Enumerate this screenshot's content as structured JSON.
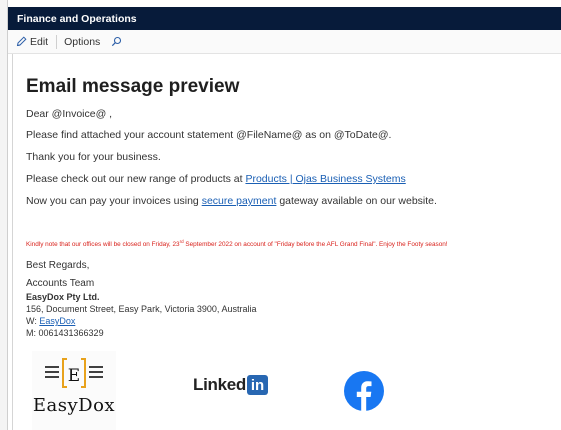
{
  "app": {
    "title": "Finance and Operations"
  },
  "toolbar": {
    "edit_label": "Edit",
    "options_label": "Options"
  },
  "email": {
    "heading": "Email message preview",
    "greeting": "Dear @Invoice@ ,",
    "line1": "Please find attached your account statement @FileName@ as on @ToDate@.",
    "line2": "Thank you for your business.",
    "line3_prefix": "Please check out our new range of products at ",
    "line3_link": "Products | Ojas Business Systems",
    "line4_prefix": "Now you can pay your invoices using ",
    "line4_link": "secure payment",
    "line4_suffix": " gateway available on our website.",
    "notice_prefix": "Kindly note that our offices will be closed on Friday, 23",
    "notice_sup": "rd",
    "notice_suffix": " September 2022 on account of \"Friday before the AFL Grand Final\". Enjoy the Footy season!",
    "colors": {
      "notice": "#d9221c",
      "link": "#1a5fb4",
      "titlebar": "#071b3a"
    }
  },
  "signature": {
    "regards": "Best Regards,",
    "team": "Accounts Team",
    "company": "EasyDox Pty Ltd.",
    "address": "156, Document Street, Easy Park, Victoria 3900, Australia",
    "web_prefix": "W: ",
    "web_link": "EasyDox",
    "mobile": "M: 0061431366329"
  },
  "logos": {
    "easydox_letter": "E",
    "easydox_name": "EasyDox",
    "linkedin_text": "Linked",
    "linkedin_box": "in",
    "facebook_icon": "facebook-icon"
  }
}
